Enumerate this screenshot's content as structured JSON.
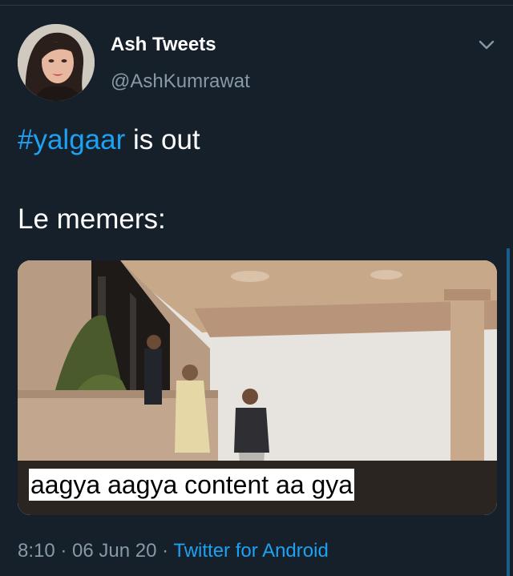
{
  "tweet": {
    "author": {
      "display_name": "Ash Tweets",
      "handle": "@AshKumrawat",
      "avatar_icon": "profile-photo"
    },
    "text": {
      "hashtag": "#yalgaar",
      "line1_rest": " is out",
      "line2": "Le memers:"
    },
    "media": {
      "caption": "aagya aagya content aa gya"
    },
    "meta": {
      "time": "8:10",
      "sep1": " · ",
      "date": "06 Jun 20",
      "sep2": " · ",
      "source": "Twitter for Android"
    },
    "more_icon": "chevron-down-icon"
  },
  "colors": {
    "background": "#15202b",
    "accent": "#1da1f2",
    "secondary_text": "#8899a6"
  }
}
